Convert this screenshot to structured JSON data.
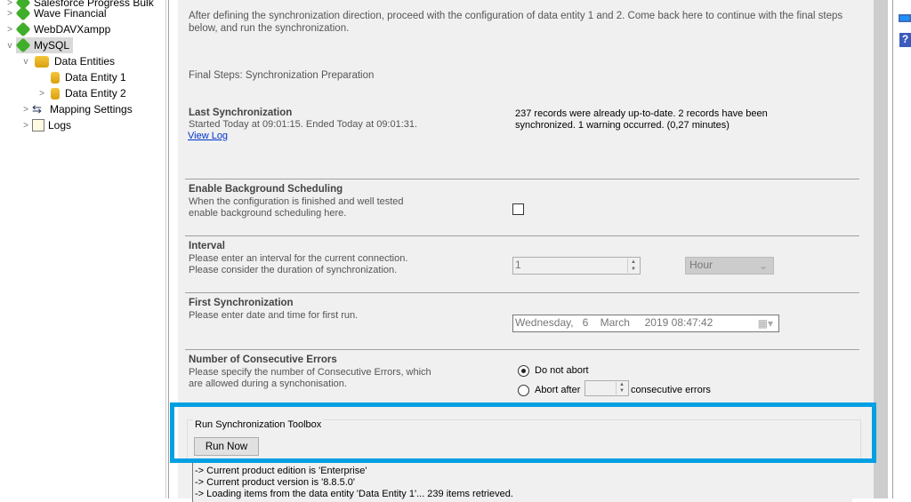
{
  "tree": {
    "items": [
      {
        "label": "Salesforce Progress Bulk",
        "level": 0,
        "icon": "puzzle-icon"
      },
      {
        "label": "Wave Financial",
        "level": 0,
        "icon": "puzzle-icon"
      },
      {
        "label": "WebDAVXampp",
        "level": 0,
        "icon": "puzzle-icon"
      },
      {
        "label": "MySQL",
        "level": 0,
        "icon": "puzzle-icon",
        "selected": true,
        "expanded": true
      },
      {
        "label": "Data Entities",
        "level": 1,
        "icon": "database-icon",
        "expanded": true
      },
      {
        "label": "Data Entity 1",
        "level": 2,
        "icon": "database-icon"
      },
      {
        "label": "Data Entity 2",
        "level": 2,
        "icon": "database-icon"
      },
      {
        "label": "Mapping Settings",
        "level": 1,
        "icon": "mapping-icon"
      },
      {
        "label": "Logs",
        "level": 1,
        "icon": "logs-icon"
      }
    ]
  },
  "main": {
    "intro": "After defining the synchronization direction, proceed with the configuration of data entity 1 and 2. Come back here to continue with the final steps below, and run the synchronization.",
    "final_steps": "Final Steps: Synchronization Preparation",
    "last_sync": {
      "title": "Last Synchronization",
      "desc": "Started  Today at 09:01:15. Ended Today at 09:01:31.",
      "link": "View Log",
      "result": "237 records were already up-to-date. 2 records have been synchronized. 1 warning occurred. (0,27 minutes)"
    },
    "background": {
      "title": "Enable Background Scheduling",
      "desc1": "When the configuration is finished and well tested",
      "desc2": "enable background scheduling here.",
      "checked": false
    },
    "interval": {
      "title": "Interval",
      "desc1": "Please enter an interval for the current connection.",
      "desc2": "Please consider the duration of synchronization.",
      "value": "1",
      "unit": "Hour"
    },
    "first_sync": {
      "title": "First Synchronization",
      "desc": "Please enter date and time for first run.",
      "value": "Wednesday,   6    March     2019 08:47:42"
    },
    "errors": {
      "title": "Number of Consecutive Errors",
      "desc1": "Please specify the number of Consecutive Errors, which",
      "desc2": "are allowed during a synchonisation.",
      "opt1": "Do not abort",
      "opt2": "Abort after",
      "suffix": "consecutive errors",
      "selected": "Do not abort"
    },
    "toolbox": {
      "title": "Run Synchronization Toolbox",
      "run": "Run Now"
    },
    "log": [
      "-> Current product edition is 'Enterprise'",
      "-> Current product version is '8.8.5.0'",
      "-> Loading items from the data entity 'Data Entity 1'... 239 items retrieved."
    ]
  },
  "colors": {
    "highlight": "#00a0e3"
  }
}
